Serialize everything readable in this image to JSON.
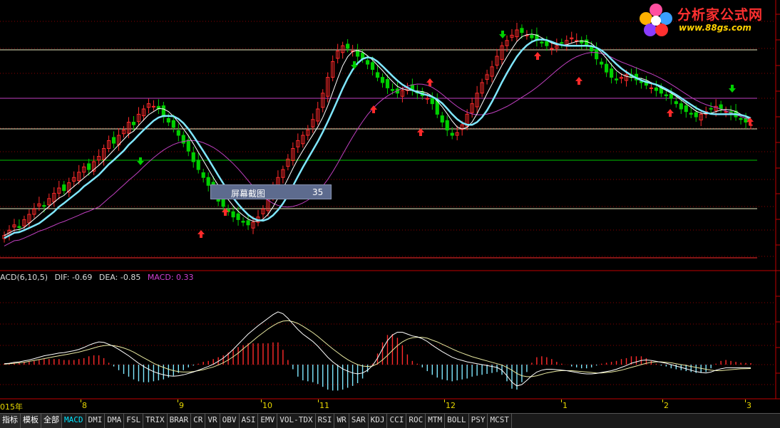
{
  "logo": {
    "name": "分析家公式网",
    "url": "www.88gs.com"
  },
  "tooltip": {
    "label": "屏幕截图",
    "value": "35"
  },
  "macd_header": {
    "name": "ACD(6,10,5)",
    "dif": "DIF: -0.69",
    "dea": "DEA: -0.85",
    "macd": "MACD: 0.33"
  },
  "colors": {
    "up": "#ff2a2a",
    "down": "#00d000",
    "ma_fast": "#ffffff",
    "ma_cyan": "#7fe7ff",
    "ma_slow": "#c040c0",
    "grid": "#8b0000",
    "axis": "#c00000"
  },
  "x_labels": [
    "015年",
    "8",
    "9",
    "10",
    "11",
    "12",
    "1",
    "2",
    "3"
  ],
  "tabs_cn": [
    "指标",
    "模板",
    "全部"
  ],
  "tabs": [
    "MACD",
    "DMI",
    "DMA",
    "FSL",
    "TRIX",
    "BRAR",
    "CR",
    "VR",
    "OBV",
    "ASI",
    "EMV",
    "VOL-TDX",
    "RSI",
    "WR",
    "SAR",
    "KDJ",
    "CCI",
    "ROC",
    "MTM",
    "BOLL",
    "PSY",
    "MCST"
  ],
  "chart_data": {
    "type": "candlestick",
    "title": "",
    "xlabel": "",
    "ylabel": "",
    "price_range": [
      0,
      100
    ],
    "candles_close": [
      12,
      14,
      16,
      15,
      18,
      20,
      22,
      24,
      23,
      26,
      28,
      30,
      29,
      32,
      34,
      36,
      38,
      37,
      40,
      42,
      45,
      48,
      47,
      50,
      52,
      55,
      54,
      58,
      60,
      62,
      61,
      60,
      57,
      55,
      53,
      50,
      47,
      44,
      40,
      37,
      34,
      31,
      28,
      25,
      23,
      21,
      19,
      18,
      17,
      16,
      17,
      19,
      22,
      26,
      30,
      34,
      37,
      41,
      45,
      48,
      50,
      52,
      56,
      60,
      66,
      72,
      78,
      82,
      84,
      83,
      82,
      80,
      79,
      77,
      75,
      72,
      70,
      68,
      67,
      66,
      67,
      68,
      67,
      66,
      65,
      64,
      62,
      58,
      55,
      52,
      50,
      51,
      54,
      58,
      62,
      66,
      70,
      73,
      76,
      80,
      84,
      86,
      88,
      90,
      89,
      88,
      87,
      86,
      85,
      84,
      83,
      84,
      85,
      86,
      87,
      86,
      85,
      84,
      82,
      79,
      77,
      74,
      72,
      71,
      72,
      73,
      72,
      71,
      70,
      69,
      68,
      67,
      66,
      65,
      64,
      62,
      60,
      59,
      58,
      57,
      58,
      59,
      60,
      61,
      60,
      59,
      58,
      57,
      56,
      55,
      54
    ],
    "indicator": {
      "name": "MACD",
      "dif": [
        0.2,
        0.3,
        0.5,
        0.6,
        0.8,
        1.0,
        1.3,
        1.6,
        1.9,
        2.1,
        2.3,
        2.5,
        2.6,
        2.8,
        3.0,
        3.3,
        3.7,
        4.2,
        4.6,
        4.9,
        4.8,
        4.4,
        3.9,
        3.3,
        2.6,
        1.9,
        1.1,
        0.3,
        -0.4,
        -1.0,
        -1.5,
        -1.9,
        -2.2,
        -2.4,
        -2.5,
        -2.4,
        -2.2,
        -1.9,
        -1.6,
        -1.2,
        -0.8,
        -0.4,
        0.1,
        0.7,
        1.4,
        2.3,
        3.3,
        4.4,
        5.5,
        6.6,
        7.5,
        8.4,
        9.2,
        10.0,
        10.8,
        11.4,
        11.0,
        10.0,
        8.8,
        7.6,
        6.6,
        5.8,
        5.0,
        4.0,
        2.8,
        1.6,
        0.6,
        -0.2,
        -0.9,
        -1.4,
        -1.8,
        -2.0,
        -1.8,
        -1.2,
        -0.2,
        1.4,
        3.4,
        5.2,
        6.4,
        7.0,
        7.0,
        6.6,
        6.2,
        6.0,
        5.6,
        5.0,
        4.2,
        3.5,
        2.8,
        2.2,
        1.6,
        1.2,
        0.9,
        0.6,
        0.4,
        0.2,
        0,
        -0.2,
        -0.4,
        -0.6,
        -1.2,
        -2.4,
        -3.8,
        -4.6,
        -4.3,
        -3.4,
        -2.4,
        -1.6,
        -1.2,
        -1.0,
        -1.0,
        -1.1,
        -1.2,
        -1.3,
        -1.5,
        -1.7,
        -1.9,
        -2.0,
        -2.0,
        -1.9,
        -1.7,
        -1.5,
        -1.3,
        -1.0,
        -0.6,
        -0.2,
        0.3,
        0.6,
        0.9,
        1.0,
        0.9,
        0.7,
        0.5,
        0.3,
        0,
        -0.3,
        -0.6,
        -0.9,
        -1.2,
        -1.5,
        -1.7,
        -1.8,
        -1.6,
        -1.2,
        -0.9,
        -0.7,
        -0.7,
        -0.7,
        -0.7,
        -0.69,
        -0.69
      ],
      "dea": [
        0.1,
        0.2,
        0.3,
        0.4,
        0.5,
        0.7,
        0.9,
        1.1,
        1.3,
        1.5,
        1.7,
        1.9,
        2.1,
        2.3,
        2.5,
        2.7,
        3.0,
        3.3,
        3.6,
        3.9,
        4.1,
        4.2,
        4.1,
        3.9,
        3.6,
        3.2,
        2.7,
        2.1,
        1.5,
        0.9,
        0.3,
        -0.2,
        -0.6,
        -1.0,
        -1.3,
        -1.5,
        -1.6,
        -1.6,
        -1.5,
        -1.3,
        -1.1,
        -0.8,
        -0.5,
        -0.1,
        0.4,
        1.0,
        1.7,
        2.5,
        3.4,
        4.3,
        5.2,
        6.1,
        6.9,
        7.7,
        8.4,
        9.0,
        9.4,
        9.5,
        9.3,
        8.9,
        8.3,
        7.6,
        6.9,
        6.1,
        5.2,
        4.3,
        3.4,
        2.6,
        1.8,
        1.1,
        0.5,
        0,
        -0.3,
        -0.4,
        -0.3,
        0.2,
        1.0,
        2.0,
        3.1,
        4.1,
        4.9,
        5.5,
        5.8,
        5.9,
        5.9,
        5.7,
        5.3,
        4.9,
        4.4,
        3.9,
        3.4,
        2.9,
        2.5,
        2.1,
        1.7,
        1.4,
        1.1,
        0.8,
        0.5,
        0.2,
        -0.1,
        -0.6,
        -1.2,
        -1.9,
        -2.4,
        -2.6,
        -2.6,
        -2.4,
        -2.1,
        -1.8,
        -1.6,
        -1.4,
        -1.3,
        -1.3,
        -1.3,
        -1.4,
        -1.5,
        -1.6,
        -1.7,
        -1.8,
        -1.8,
        -1.7,
        -1.6,
        -1.4,
        -1.2,
        -0.9,
        -0.6,
        -0.3,
        0,
        0.3,
        0.5,
        0.6,
        0.6,
        0.5,
        0.4,
        0.2,
        0,
        -0.2,
        -0.4,
        -0.6,
        -0.8,
        -1.0,
        -1.2,
        -1.3,
        -1.3,
        -1.2,
        -1.1,
        -1.0,
        -0.9,
        -0.87,
        -0.85
      ]
    }
  }
}
